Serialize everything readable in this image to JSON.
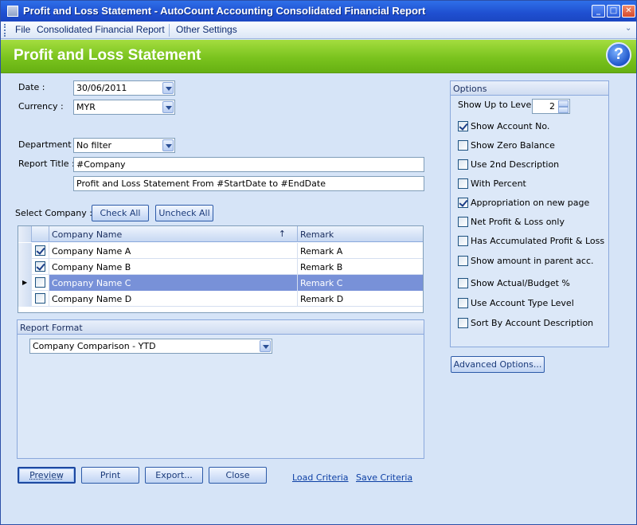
{
  "window": {
    "title": "Profit and Loss Statement - AutoCount Accounting Consolidated Financial Report",
    "controls": {
      "minimize": "_",
      "maximize": "□",
      "close": "✕"
    }
  },
  "menu": {
    "items": [
      "File",
      "Consolidated Financial Report",
      "Other Settings"
    ]
  },
  "header": {
    "title": "Profit and Loss Statement",
    "help_icon": "?"
  },
  "form": {
    "date_label": "Date :",
    "date_value": "30/06/2011",
    "currency_label": "Currency :",
    "currency_value": "MYR",
    "department_label": "Department :",
    "department_value": "No filter",
    "report_title_label": "Report Title :",
    "report_title_value": "#Company",
    "report_subtitle_value": "Profit and Loss Statement From #StartDate to #EndDate",
    "select_company_label": "Select Company :",
    "check_all_label": "Check All",
    "uncheck_all_label": "Uncheck All"
  },
  "company_grid": {
    "columns": [
      "Company Name",
      "Remark"
    ],
    "rows": [
      {
        "checked": true,
        "name": "Company Name A",
        "remark": "Remark A",
        "selected": false
      },
      {
        "checked": true,
        "name": "Company Name B",
        "remark": "Remark B",
        "selected": false
      },
      {
        "checked": false,
        "name": "Company Name C",
        "remark": "Remark C",
        "selected": true
      },
      {
        "checked": false,
        "name": "Company Name D",
        "remark": "Remark D",
        "selected": false
      }
    ]
  },
  "report_format": {
    "title": "Report Format",
    "value": "Company Comparison - YTD"
  },
  "options": {
    "title": "Options",
    "show_up_to_level_label": "Show Up to Level",
    "show_up_to_level_value": "2",
    "items": [
      {
        "label": "Show Account No.",
        "checked": true
      },
      {
        "label": "Show Zero Balance",
        "checked": false
      },
      {
        "label": "Use 2nd Description",
        "checked": false
      },
      {
        "label": "With Percent",
        "checked": false
      },
      {
        "label": "Appropriation on new page",
        "checked": true
      },
      {
        "label": "Net Profit & Loss only",
        "checked": false
      },
      {
        "label": "Has Accumulated Profit & Loss",
        "checked": false
      },
      {
        "label": "Show amount in parent acc.",
        "checked": false
      },
      {
        "label": "Show Actual/Budget %",
        "checked": false
      },
      {
        "label": "Use Account Type Level",
        "checked": false
      },
      {
        "label": "Sort By Account Description",
        "checked": false
      }
    ],
    "advanced_label": "Advanced Options..."
  },
  "actions": {
    "preview": "Preview",
    "print": "Print",
    "export": "Export...",
    "close": "Close",
    "load_criteria": "Load Criteria",
    "save_criteria": "Save Criteria"
  },
  "colors": {
    "titlebar": "#1f4fd0",
    "header_green": "#7ac31e",
    "form_bg": "#d6e4f7",
    "selected_row": "#7891d8"
  }
}
